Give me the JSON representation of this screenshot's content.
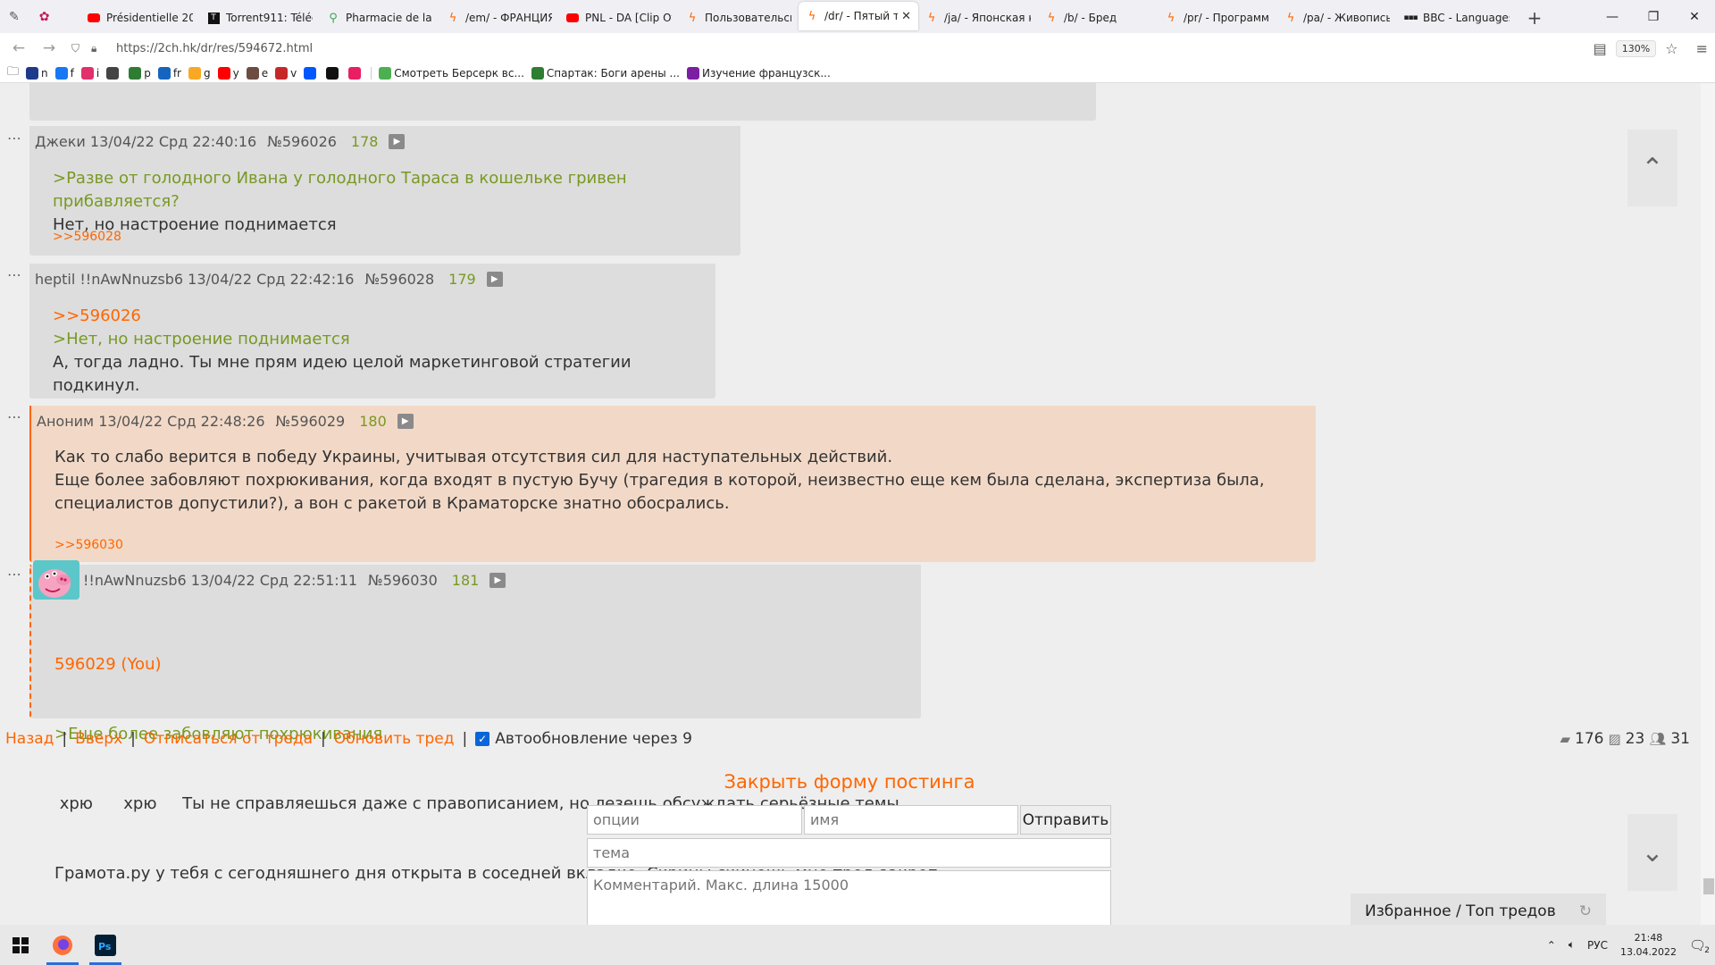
{
  "browser": {
    "tabs": [
      {
        "title": "Présidentielle 202",
        "icon": "youtube-icon"
      },
      {
        "title": "Torrent911: Téléch",
        "icon": "torrent-icon"
      },
      {
        "title": "Pharmacie de la P",
        "icon": "maps-icon"
      },
      {
        "title": "/em/ - ФРАНЦИЯ",
        "icon": "2ch-icon"
      },
      {
        "title": "PNL - DA [Clip Of",
        "icon": "youtube-icon"
      },
      {
        "title": "Пользовательск",
        "icon": "2ch-icon"
      },
      {
        "title": "/dr/ - Пятый т",
        "icon": "2ch-icon",
        "active": true
      },
      {
        "title": "/ja/ - Японская к",
        "icon": "2ch-icon"
      },
      {
        "title": "/b/ - Бред",
        "icon": "2ch-icon"
      },
      {
        "title": "/pr/ - Программ",
        "icon": "2ch-icon"
      },
      {
        "title": "/pa/ - Живопись",
        "icon": "2ch-icon"
      },
      {
        "title": "BBC - Languages",
        "icon": "bbc-icon"
      }
    ],
    "url": "https://2ch.hk/dr/res/594672.html",
    "zoom": "130%",
    "bookmarks": [
      {
        "label": "n"
      },
      {
        "label": "f"
      },
      {
        "label": "i"
      },
      {
        "label": ""
      },
      {
        "label": "p"
      },
      {
        "label": "fr"
      },
      {
        "label": "g"
      },
      {
        "label": "y"
      },
      {
        "label": "e"
      },
      {
        "label": "v"
      },
      {
        "label": ""
      },
      {
        "label": ""
      },
      {
        "label": ""
      },
      {
        "label": "Смотреть Берсерк вс..."
      },
      {
        "label": "Спартак: Боги арены ..."
      },
      {
        "label": "Изучение французск..."
      }
    ]
  },
  "posts": [
    {
      "author": "Джеки",
      "date": "13/04/22 Срд 22:40:16",
      "num": "№596026",
      "count": "178",
      "lines": [
        {
          "type": "green",
          "text": ">Разве от голодного Ивана у голодного Тараса в кошельке гривен прибавляется?"
        },
        {
          "type": "text",
          "text": "Нет, но настроение поднимается"
        }
      ],
      "replies": ">>596028"
    },
    {
      "author": "heptil !!nAwNnuzsb6",
      "date": "13/04/22 Срд 22:42:16",
      "num": "№596028",
      "count": "179",
      "lines": [
        {
          "type": "orange",
          "text": ">>596026"
        },
        {
          "type": "green",
          "text": ">Нет, но настроение поднимается"
        },
        {
          "type": "text",
          "text": "А, тогда ладно. Ты мне прям идею целой маркетинговой стратегии подкинул."
        }
      ],
      "replies": ""
    },
    {
      "author": "Аноним",
      "date": "13/04/22 Срд 22:48:26",
      "num": "№596029",
      "count": "180",
      "lines": [
        {
          "type": "text",
          "text": "Как то слабо верится в победу Украины, учитывая отсутствия сил для наступательных действий."
        },
        {
          "type": "text",
          "text": "Еще более забовляют похрюкивания, когда входят в пустую Бучу (трагедия в которой, неизвестно еще кем была сделана, экспертиза была,"
        },
        {
          "type": "text",
          "text": "специалистов допустили?), а вон с ракетой в Краматорске знатно обосрались."
        }
      ],
      "replies": ">>596030"
    },
    {
      "author": "!!nAwNnuzsb6",
      "date": "13/04/22 Срд 22:51:11",
      "num": "№596030",
      "count": "181",
      "lines": [
        {
          "type": "orange",
          "text": "596029 (You)"
        },
        {
          "type": "green",
          "text": ">Еще более забовляют похрюкивания"
        },
        {
          "type": "text",
          "text": " хрю      хрю     Ты не справляешься даже с правописанием, но лезешь обсуждать серьёзные темы."
        },
        {
          "type": "text",
          "text": "Грамота.ру у тебя с сегодняшнего дня открыта в соседней вкладке. Скрины скинешь мне тред-закреп."
        }
      ],
      "replies": ""
    }
  ],
  "thread_nav": {
    "back": "Назад",
    "up": "Вверх",
    "unsubscribe": "Отписаться от треда",
    "refresh": "Обновить тред",
    "auto": "Автообновление через 9"
  },
  "stats": {
    "posts": "176",
    "images": "23",
    "users": "31"
  },
  "form": {
    "title": "Закрыть форму постинга",
    "options_placeholder": "опции",
    "name_placeholder": "имя",
    "send_label": "Отправить",
    "subject_placeholder": "тема",
    "comment_placeholder": "Комментарий. Макс. длина 15000"
  },
  "favorites": "Избранное / Топ тредов",
  "taskbar": {
    "lang": "РУС",
    "time": "21:48",
    "date": "13.04.2022",
    "notifications": "2"
  },
  "colors": {
    "accent": "#ff6600",
    "greentext": "#789922",
    "post_bg": "#dddddd",
    "highlight_bg": "#f2d9c7"
  }
}
